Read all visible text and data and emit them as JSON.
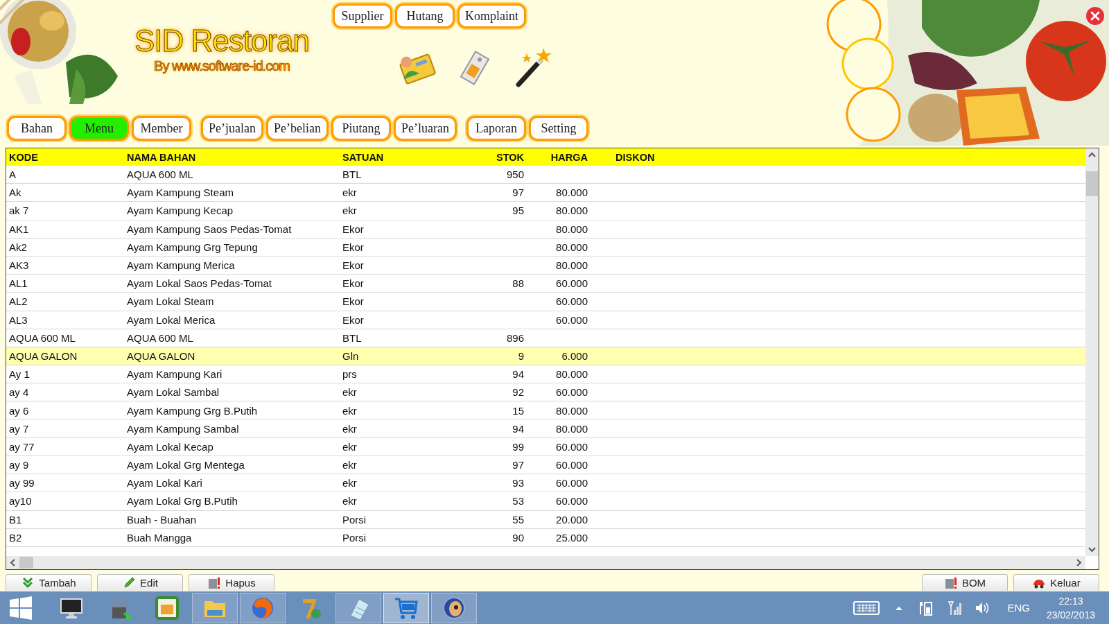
{
  "window": {
    "title": "SID Restoran",
    "subtitle": "By www.software-id.com"
  },
  "top_buttons": [
    {
      "label": "Supplier"
    },
    {
      "label": "Hutang"
    },
    {
      "label": "Komplaint"
    }
  ],
  "nav_groups": [
    [
      {
        "label": "Bahan",
        "selected": false
      },
      {
        "label": "Menu",
        "selected": true
      },
      {
        "label": "Member",
        "selected": false
      }
    ],
    [
      {
        "label": "Pe’jualan",
        "selected": false
      },
      {
        "label": "Pe’belian",
        "selected": false
      },
      {
        "label": "Piutang",
        "selected": false
      },
      {
        "label": "Pe’luaran",
        "selected": false
      }
    ],
    [
      {
        "label": "Laporan",
        "selected": false
      },
      {
        "label": "Setting",
        "selected": false
      }
    ]
  ],
  "table": {
    "columns": [
      "KODE",
      "NAMA BAHAN",
      "SATUAN",
      "STOK",
      "HARGA",
      "DISKON"
    ],
    "rows": [
      {
        "kode": "A",
        "nama": "AQUA 600 ML",
        "satuan": "BTL",
        "stok": "950",
        "selected": false
      },
      {
        "kode": "Ak",
        "nama": "Ayam Kampung Steam",
        "satuan": "ekr",
        "stok": "97",
        "harga": "80.000",
        "selected": false
      },
      {
        "kode": "ak 7",
        "nama": "Ayam Kampung Kecap",
        "satuan": "ekr",
        "stok": "95",
        "harga": "80.000",
        "selected": false
      },
      {
        "kode": "AK1",
        "nama": "Ayam Kampung Saos Pedas-Tomat",
        "satuan": "Ekor",
        "harga": "80.000",
        "selected": false
      },
      {
        "kode": "Ak2",
        "nama": "Ayam Kampung Grg Tepung",
        "satuan": "Ekor",
        "harga": "80.000",
        "selected": false
      },
      {
        "kode": "AK3",
        "nama": "Ayam Kampung Merica",
        "satuan": "Ekor",
        "harga": "80.000",
        "selected": false
      },
      {
        "kode": "AL1",
        "nama": "Ayam Lokal Saos Pedas-Tomat",
        "satuan": "Ekor",
        "stok": "88",
        "harga": "60.000",
        "selected": false
      },
      {
        "kode": "AL2",
        "nama": "Ayam Lokal Steam",
        "satuan": "Ekor",
        "harga": "60.000",
        "selected": false
      },
      {
        "kode": "AL3",
        "nama": "Ayam Lokal Merica",
        "satuan": "Ekor",
        "harga": "60.000",
        "selected": false
      },
      {
        "kode": "AQUA 600 ML",
        "nama": "AQUA 600 ML",
        "satuan": "BTL",
        "stok": "896",
        "selected": false
      },
      {
        "kode": "AQUA GALON",
        "nama": "AQUA GALON",
        "satuan": "Gln",
        "stok": "9",
        "harga": "6.000",
        "selected": true
      },
      {
        "kode": "Ay 1",
        "nama": "Ayam Kampung Kari",
        "satuan": "prs",
        "stok": "94",
        "harga": "80.000",
        "selected": false
      },
      {
        "kode": "ay 4",
        "nama": "Ayam Lokal Sambal",
        "satuan": "ekr",
        "stok": "92",
        "harga": "60.000",
        "selected": false
      },
      {
        "kode": "ay 6",
        "nama": "Ayam Kampung Grg B.Putih",
        "satuan": "ekr",
        "stok": "15",
        "harga": "80.000",
        "selected": false
      },
      {
        "kode": "ay 7",
        "nama": "Ayam Kampung Sambal",
        "satuan": "ekr",
        "stok": "94",
        "harga": "80.000",
        "selected": false
      },
      {
        "kode": "ay 77",
        "nama": "Ayam Lokal Kecap",
        "satuan": "ekr",
        "stok": "99",
        "harga": "60.000",
        "selected": false
      },
      {
        "kode": "ay 9",
        "nama": "Ayam Lokal Grg Mentega",
        "satuan": "ekr",
        "stok": "97",
        "harga": "60.000",
        "selected": false
      },
      {
        "kode": "ay 99",
        "nama": "Ayam Lokal Kari",
        "satuan": "ekr",
        "stok": "93",
        "harga": "60.000",
        "selected": false
      },
      {
        "kode": "ay10",
        "nama": "Ayam Lokal Grg B.Putih",
        "satuan": "ekr",
        "stok": "53",
        "harga": "60.000",
        "selected": false
      },
      {
        "kode": "B1",
        "nama": "Buah - Buahan",
        "satuan": "Porsi",
        "stok": "55",
        "harga": "20.000",
        "selected": false
      },
      {
        "kode": "B2",
        "nama": "Buah Mangga",
        "satuan": "Porsi",
        "stok": "90",
        "harga": "25.000",
        "selected": false
      }
    ]
  },
  "actions_left": [
    {
      "label": "Tambah",
      "kind": "add"
    },
    {
      "label": "Edit",
      "kind": "edit"
    },
    {
      "label": "Hapus",
      "kind": "delete"
    }
  ],
  "actions_right": [
    {
      "label": "BOM",
      "kind": "bom"
    },
    {
      "label": "Keluar",
      "kind": "exit"
    }
  ],
  "taskbar": {
    "apps": [
      {
        "kind": "monitor",
        "open": false,
        "active": false
      },
      {
        "kind": "lock",
        "open": false,
        "active": false
      },
      {
        "kind": "hs",
        "open": false,
        "active": false
      },
      {
        "kind": "folder",
        "open": true,
        "active": false
      },
      {
        "kind": "browser",
        "open": true,
        "active": false
      },
      {
        "kind": "seven",
        "open": false,
        "active": false
      },
      {
        "kind": "notepad",
        "open": true,
        "active": false
      },
      {
        "kind": "cart",
        "open": true,
        "active": true
      },
      {
        "kind": "eye",
        "open": true,
        "active": false
      }
    ],
    "language": "ENG",
    "time": "22:13",
    "date": "23/02/2013"
  }
}
